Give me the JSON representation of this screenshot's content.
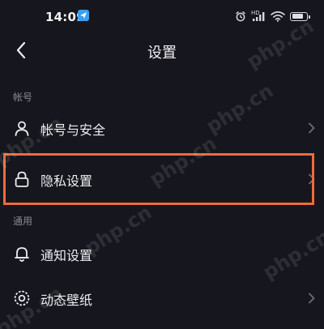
{
  "status_bar": {
    "time": "14:09",
    "network_label": "HD"
  },
  "nav": {
    "title": "设置"
  },
  "sections": [
    {
      "header": "帐号",
      "items": [
        {
          "label": "帐号与安全",
          "icon": "user-icon"
        },
        {
          "label": "隐私设置",
          "icon": "lock-icon"
        }
      ]
    },
    {
      "header": "通用",
      "items": [
        {
          "label": "通知设置",
          "icon": "bell-icon"
        },
        {
          "label": "动态壁纸",
          "icon": "wallpaper-icon"
        }
      ]
    }
  ],
  "watermark": "php.cn",
  "colors": {
    "background": "#16161e",
    "highlight": "#ef6a3d"
  }
}
